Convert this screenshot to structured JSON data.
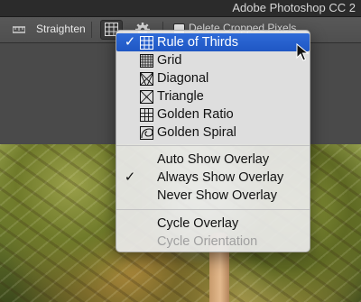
{
  "window": {
    "title": "Adobe Photoshop CC 2"
  },
  "toolbar": {
    "straighten_label": "Straighten",
    "delete_cropped_label": "Delete Cropped Pixels",
    "delete_cropped_checked": false
  },
  "overlay_menu": {
    "items": [
      {
        "label": "Rule of Thirds",
        "icon": "rule-of-thirds-icon",
        "checked": true,
        "selected": true
      },
      {
        "label": "Grid",
        "icon": "grid-icon",
        "checked": false
      },
      {
        "label": "Diagonal",
        "icon": "diagonal-icon",
        "checked": false
      },
      {
        "label": "Triangle",
        "icon": "triangle-icon",
        "checked": false
      },
      {
        "label": "Golden Ratio",
        "icon": "golden-ratio-icon",
        "checked": false
      },
      {
        "label": "Golden Spiral",
        "icon": "golden-spiral-icon",
        "checked": false
      }
    ],
    "show_options": [
      {
        "label": "Auto Show Overlay",
        "checked": false
      },
      {
        "label": "Always Show Overlay",
        "checked": true
      },
      {
        "label": "Never Show Overlay",
        "checked": false
      }
    ],
    "cycle_options": [
      {
        "label": "Cycle Overlay",
        "enabled": true
      },
      {
        "label": "Cycle Orientation",
        "enabled": false
      }
    ]
  },
  "colors": {
    "selection": "#1f57c4",
    "menu_bg": "#eaeaea"
  }
}
